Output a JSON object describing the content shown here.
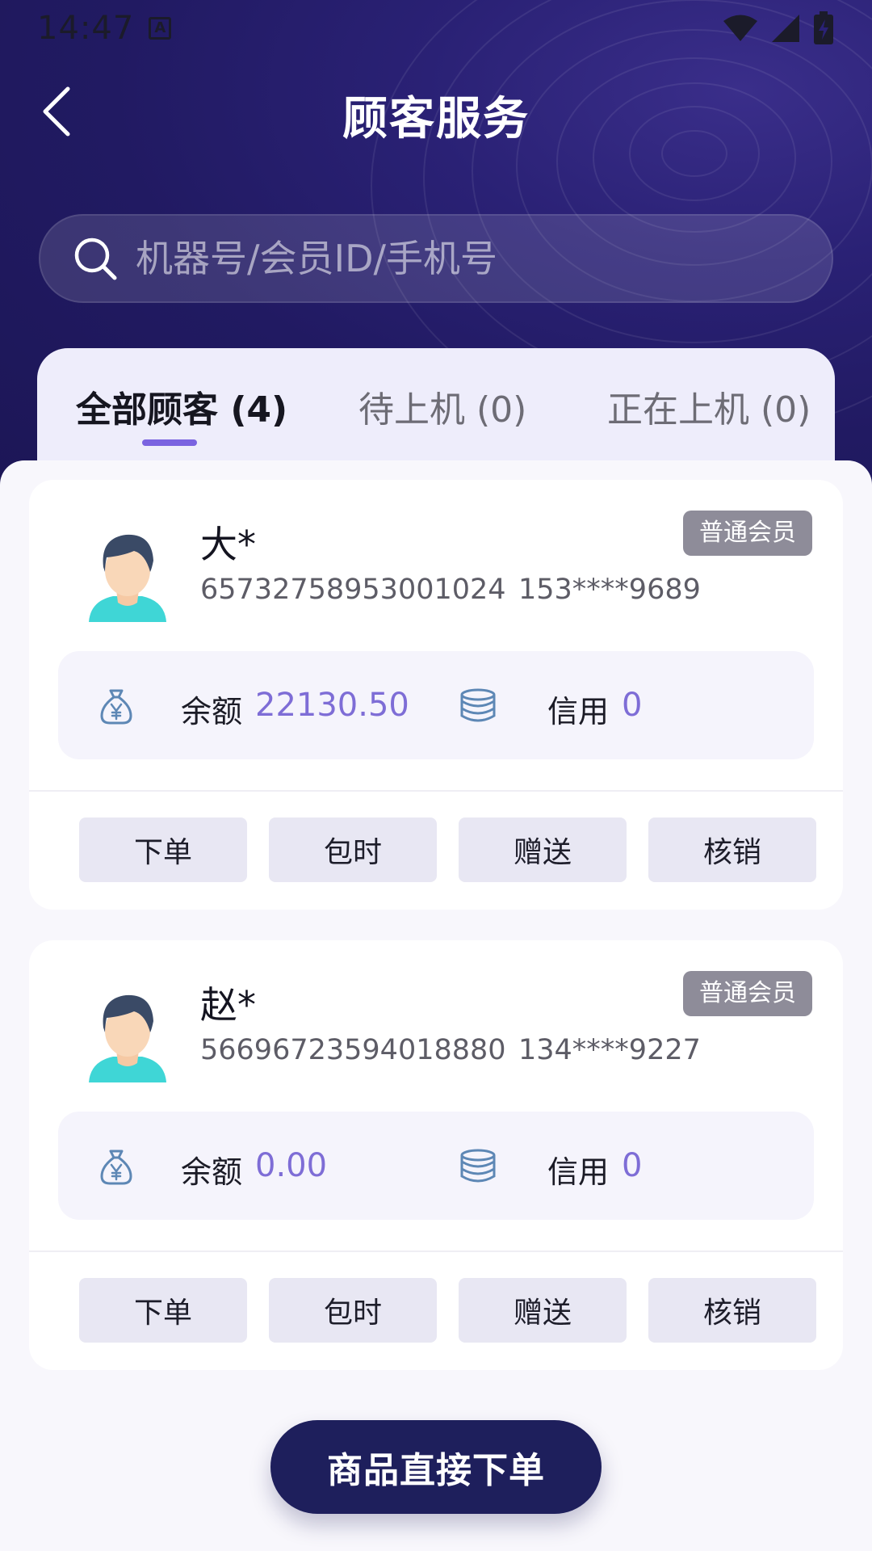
{
  "status_bar": {
    "time": "14:47"
  },
  "header": {
    "title": "顾客服务"
  },
  "search": {
    "placeholder": "机器号/会员ID/手机号"
  },
  "tabs": [
    {
      "label": "全部顾客 (4)",
      "active": true
    },
    {
      "label": "待上机 (0)",
      "active": false
    },
    {
      "label": "正在上机 (0)",
      "active": false
    }
  ],
  "customers": [
    {
      "name": "大*",
      "badge": "普通会员",
      "member_id": "65732758953001024",
      "phone": "153****9689",
      "balance_label": "余额",
      "balance": "22130.50",
      "credit_label": "信用",
      "credit": "0"
    },
    {
      "name": "赵*",
      "badge": "普通会员",
      "member_id": "56696723594018880",
      "phone": "134****9227",
      "balance_label": "余额",
      "balance": "0.00",
      "credit_label": "信用",
      "credit": "0"
    }
  ],
  "actions": {
    "order": "下单",
    "hourly": "包时",
    "gift": "赠送",
    "redeem": "核销"
  },
  "bottom": {
    "button_label": "商品直接下单"
  },
  "colors": {
    "header_bg": "#211a62",
    "accent": "#7e6dd6",
    "badge_bg": "#8e8c99",
    "primary_button": "#1e1f5c"
  },
  "icons": {
    "back": "chevron-left-icon",
    "search": "search-icon",
    "balance": "money-bag-icon",
    "credit": "coins-stack-icon",
    "avatar": "user-avatar"
  }
}
